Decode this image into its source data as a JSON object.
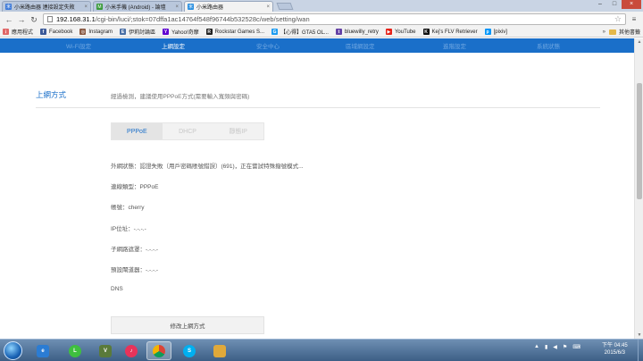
{
  "browser": {
    "tabs": [
      {
        "title": "小米路由器 連接設定失敗",
        "icon": "xiaomi-favicon",
        "color": "#3b78d8"
      },
      {
        "title": "小米手機 (Android) - 論壇",
        "icon": "forum-favicon",
        "color": "#3a9a3a"
      },
      {
        "title": "小米路由器",
        "icon": "xiaomi-router-favicon",
        "color": "#2a8fe0"
      }
    ],
    "url_host": "192.168.31.1",
    "url_path": "/cgi-bin/luci/;stok=07dffa1ac14764f548f96744b532528c/web/setting/wan",
    "bookmarks": [
      {
        "label": "應用程式",
        "icon": "apps-icon",
        "color": "#e06666"
      },
      {
        "label": "Facebook",
        "icon": "facebook-icon",
        "color": "#3b5998"
      },
      {
        "label": "Instagram",
        "icon": "instagram-icon",
        "color": "#8a5a44"
      },
      {
        "label": "伊莉討論區",
        "icon": "eyny-icon",
        "color": "#4a6fa5"
      },
      {
        "label": "Yahoo!奇摩",
        "icon": "yahoo-icon",
        "color": "#5f01d1"
      },
      {
        "label": "Rockstar Games S...",
        "icon": "rockstar-icon",
        "color": "#222222"
      },
      {
        "label": "【心得】GTA5 OL...",
        "icon": "gamer-icon",
        "color": "#1d9bf0"
      },
      {
        "label": "bluewilly_retry",
        "icon": "twitch-icon",
        "color": "#6441a5"
      },
      {
        "label": "YouTube",
        "icon": "youtube-icon",
        "color": "#e62117"
      },
      {
        "label": "Kej's FLV Retriever",
        "icon": "k-icon",
        "color": "#111111"
      },
      {
        "label": "[pixiv]",
        "icon": "pixiv-icon",
        "color": "#0096fa"
      }
    ],
    "bookmarks_more": "»",
    "other_bookmarks": "其他書籤"
  },
  "router": {
    "nav": [
      "Wi-Fi設定",
      "上網設定",
      "安全中心",
      "區域網設定",
      "進階設定",
      "系統狀態"
    ],
    "active_nav": 1,
    "section_title": "上網方式",
    "hint": "經過檢測，建議使用PPPoE方式(需要輸入寬頻與密碼)",
    "modes": [
      "PPPoE",
      "DHCP",
      "靜態IP"
    ],
    "active_mode": 0,
    "info": [
      {
        "label": "外網狀態：",
        "value": "認證失敗（用戶密碼賬號錯誤）(691)，正在嘗試特殊撥號模式..."
      },
      {
        "label": "連線類型：",
        "value": "PPPoE"
      },
      {
        "label": "帳號：",
        "value": "cherry"
      },
      {
        "label": "IP位址：",
        "value": "-.-.-.-"
      },
      {
        "label": "子網路遮罩：",
        "value": "-.-.-.-"
      },
      {
        "label": "預設閘道器：",
        "value": "-.-.-.-"
      },
      {
        "label": "DNS",
        "value": ""
      }
    ],
    "modify_button": "修改上網方式"
  },
  "taskbar": {
    "time": "下午 04:45",
    "date": "2015/6/3"
  }
}
